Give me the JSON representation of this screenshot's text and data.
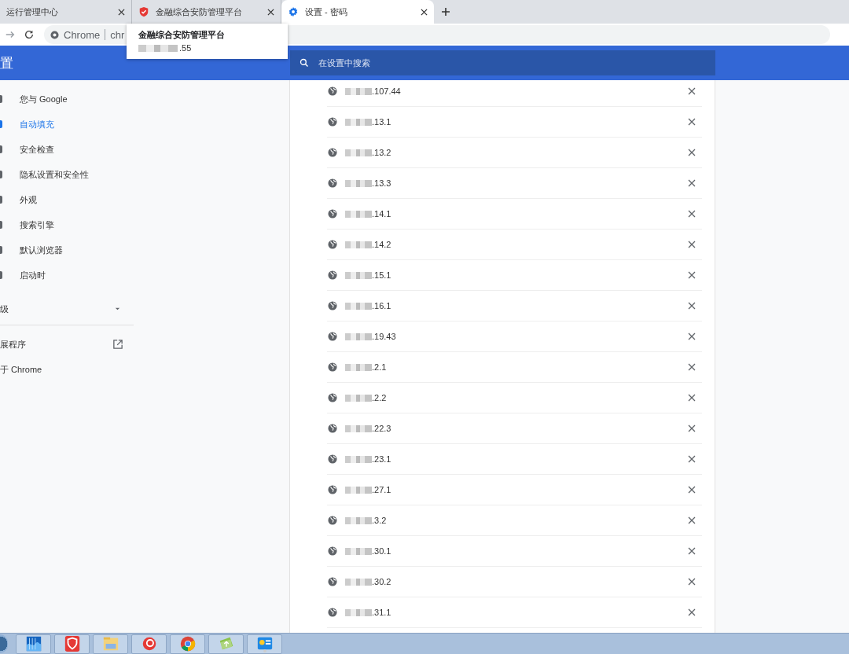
{
  "tabs": [
    {
      "kind": "plain",
      "title": "运行管理中心",
      "selected": false
    },
    {
      "kind": "shield",
      "title": "金融综合安防管理平台",
      "selected": false
    },
    {
      "kind": "gear",
      "title": "设置 - 密码",
      "selected": true
    }
  ],
  "toolbar": {
    "omnibox_label": "Chrome",
    "omnibox_url": "chr"
  },
  "tooltip": {
    "title": "金融综合安防管理平台",
    "address": ".55"
  },
  "header": {
    "title": "置",
    "search": {
      "placeholder": "在设置中搜索"
    }
  },
  "sidebar": {
    "items": [
      {
        "label": "您与 Google",
        "selected": false
      },
      {
        "label": "自动填充",
        "selected": true
      },
      {
        "label": "安全检查",
        "selected": false
      },
      {
        "label": "隐私设置和安全性",
        "selected": false
      },
      {
        "label": "外观",
        "selected": false
      },
      {
        "label": "搜索引擎",
        "selected": false
      },
      {
        "label": "默认浏览器",
        "selected": false
      },
      {
        "label": "启动时",
        "selected": false
      }
    ],
    "advanced": {
      "label": "级",
      "expanded": false
    },
    "extensions": {
      "label": "展程序"
    },
    "about": {
      "label": "于 Chrome"
    }
  },
  "passwords": [
    {
      "site": ".107.44"
    },
    {
      "site": ".13.1"
    },
    {
      "site": ".13.2"
    },
    {
      "site": ".13.3"
    },
    {
      "site": ".14.1"
    },
    {
      "site": ".14.2"
    },
    {
      "site": ".15.1"
    },
    {
      "site": ".16.1"
    },
    {
      "site": ".19.43"
    },
    {
      "site": ".2.1"
    },
    {
      "site": ".2.2"
    },
    {
      "site": ".22.3"
    },
    {
      "site": ".23.1"
    },
    {
      "site": ".27.1"
    },
    {
      "site": ".3.2"
    },
    {
      "site": ".30.1"
    },
    {
      "site": ".30.2"
    },
    {
      "site": ".31.1"
    }
  ]
}
